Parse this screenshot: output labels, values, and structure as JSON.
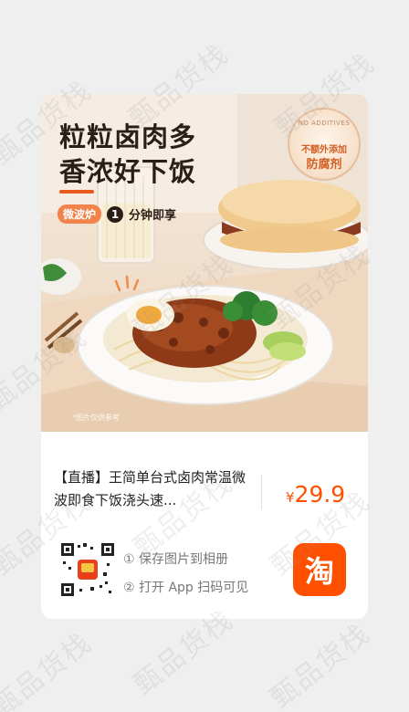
{
  "watermark": {
    "text": "甄品货栈"
  },
  "hero": {
    "headline_line1": "粒粒卤肉多",
    "headline_line2": "香浓好下饭",
    "microwave_label": "微波炉",
    "minute_number": "1",
    "minute_text": "分钟即享",
    "seal": {
      "english": "NO ADDITIVES",
      "line1": "不额外添加",
      "line2": "防腐剂"
    },
    "disclaimer": "*图片仅供参考",
    "image_description_icon": "noodle-bowl-illustration"
  },
  "product": {
    "title": "【直播】王简单台式卤肉常温微波即食下饭浇头速...",
    "price_currency": "¥",
    "price_value": "29.9"
  },
  "share": {
    "step1": "① 保存图片到相册",
    "step2": "② 打开 App 扫码可见",
    "app_icon": "taobao-icon",
    "app_glyph": "淘"
  },
  "colors": {
    "accent": "#ff5000",
    "headline": "#2b1e16",
    "seal_text": "#d35e22"
  }
}
